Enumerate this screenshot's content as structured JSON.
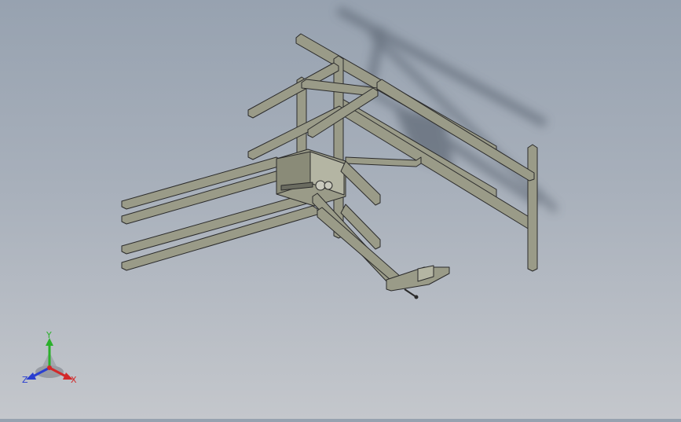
{
  "viewport": {
    "background_top": "#97a2b0",
    "background_bottom": "#c4c7cc",
    "model_fill": "#9a9b88",
    "model_edge": "#2b2b2b",
    "shadow": "#4a5260"
  },
  "triad": {
    "x_label": "X",
    "y_label": "Y",
    "z_label": "Z",
    "x_color": "#d22a2a",
    "y_color": "#2bb02b",
    "z_color": "#2a3fd0"
  }
}
